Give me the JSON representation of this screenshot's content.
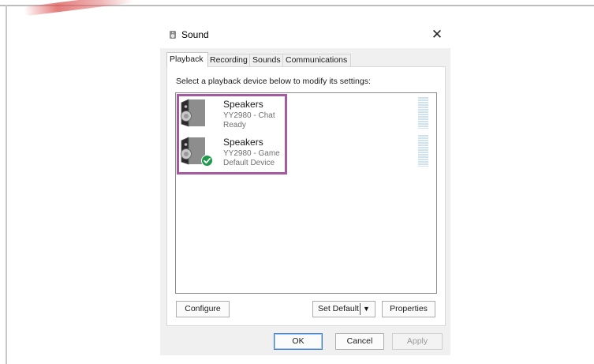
{
  "window": {
    "title": "Sound",
    "close_glyph": "✕"
  },
  "tabs": [
    {
      "label": "Playback",
      "active": true
    },
    {
      "label": "Recording",
      "active": false
    },
    {
      "label": "Sounds",
      "active": false
    },
    {
      "label": "Communications",
      "active": false
    }
  ],
  "panel": {
    "instructions": "Select a playback device below to modify its settings:"
  },
  "devices": [
    {
      "name": "Speakers",
      "line1": "YY2980 - Chat",
      "line2": "Ready",
      "is_default": false,
      "icon": "speaker-icon"
    },
    {
      "name": "Speakers",
      "line1": "YY2980 - Game",
      "line2": "Default Device",
      "is_default": true,
      "icon": "speaker-icon",
      "badge_icon": "default-check-icon"
    }
  ],
  "buttons": {
    "configure": "Configure",
    "set_default": "Set Default",
    "set_default_arrow": "▼",
    "properties": "Properties",
    "ok": "OK",
    "cancel": "Cancel",
    "apply": "Apply"
  },
  "colors": {
    "highlight": "#a55a9f",
    "default_badge": "#1e9a4a",
    "meter": "#cfe2ef",
    "ok_border": "#3a7ac9"
  }
}
